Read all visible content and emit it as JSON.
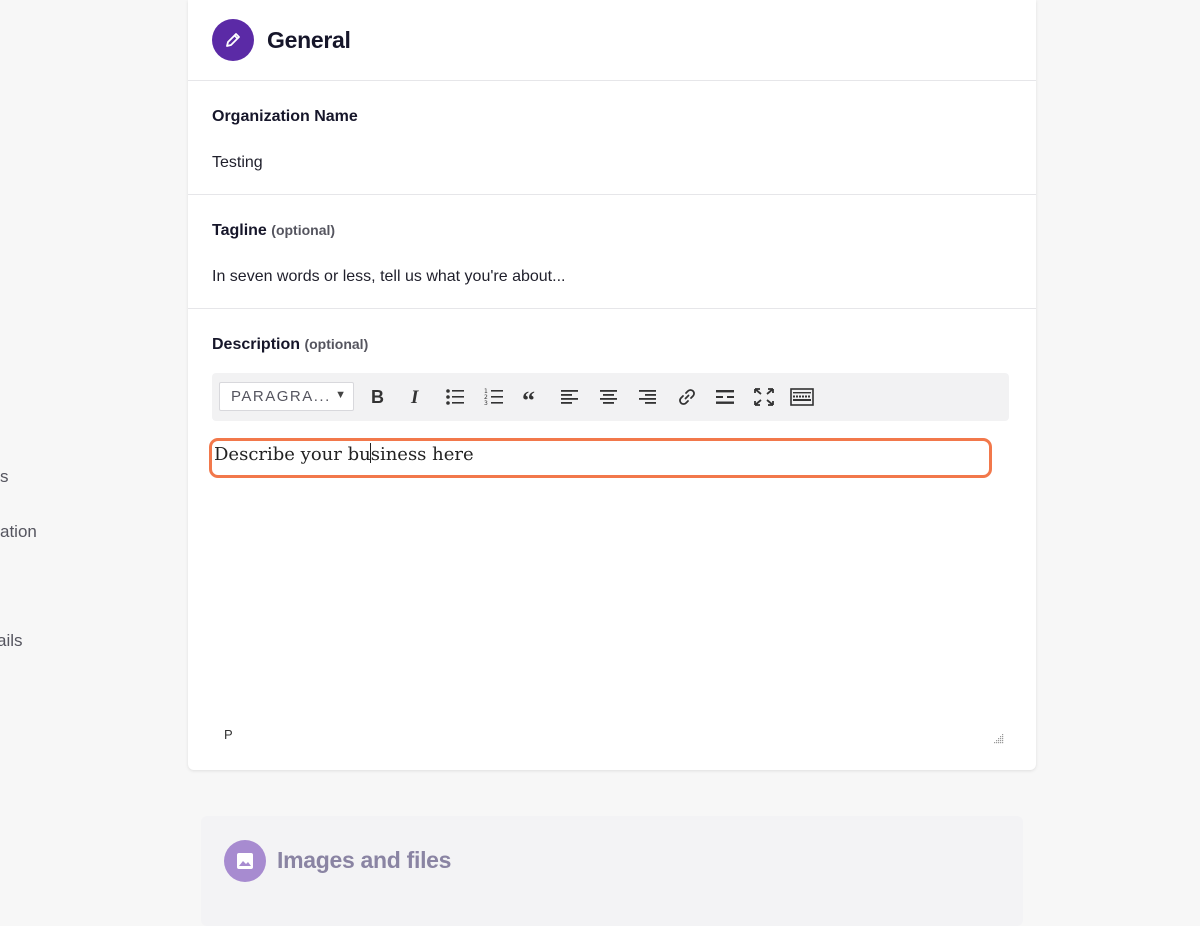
{
  "sidebar_fragments": [
    "s",
    "ation",
    "ails"
  ],
  "general": {
    "title": "General",
    "icon": "pencil-icon",
    "org_name": {
      "label": "Organization Name",
      "value": "Testing"
    },
    "tagline": {
      "label": "Tagline",
      "optional": "(optional)",
      "placeholder": "In seven words or less, tell us what you're about..."
    },
    "description": {
      "label": "Description",
      "optional": "(optional)",
      "format_select": "PARAGRA...",
      "toolbar_icons": [
        "bold-icon",
        "italic-icon",
        "bullet-list-icon",
        "numbered-list-icon",
        "quote-icon",
        "align-left-icon",
        "align-center-icon",
        "align-right-icon",
        "link-icon",
        "horizontal-rule-icon",
        "fullscreen-icon",
        "keyboard-icon"
      ],
      "text_before_caret": "Describe your bu",
      "text_after_caret": "siness here",
      "status_path": "P"
    }
  },
  "images": {
    "title": "Images and files",
    "icon": "image-icon"
  },
  "colors": {
    "accent": "#5b2aa6",
    "accent_muted": "#a78bd0",
    "highlight": "#f2784b"
  }
}
